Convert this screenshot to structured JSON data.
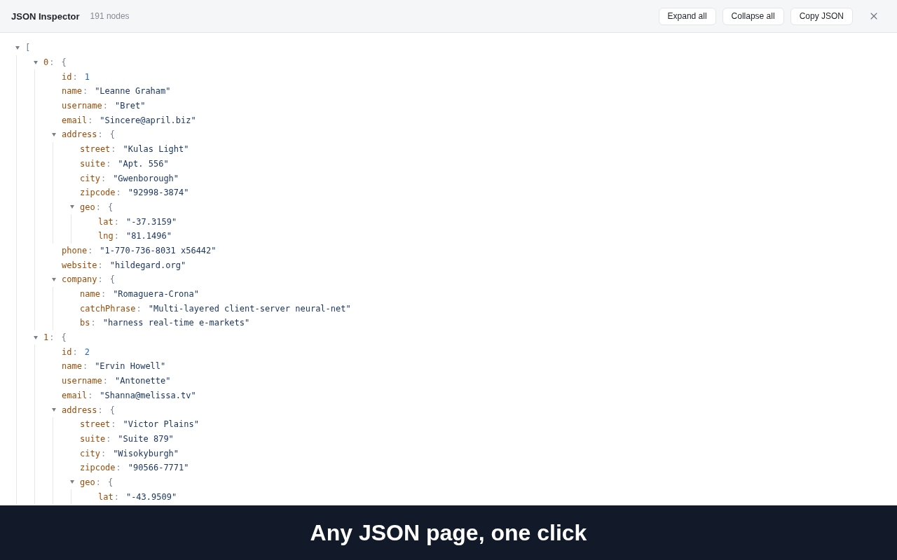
{
  "header": {
    "title": "JSON Inspector",
    "count": "191 nodes",
    "buttons": [
      "Expand all",
      "Collapse all",
      "Copy JSON"
    ]
  },
  "tree": {
    "separator": ":",
    "root": {
      "kind": "array",
      "bracket": "[",
      "expanded": true,
      "children": [
        {
          "key": "0",
          "kind": "object",
          "bracket": "{",
          "expanded": true,
          "children": [
            {
              "key": "id",
              "kind": "number",
              "value": "1"
            },
            {
              "key": "name",
              "kind": "string",
              "value": "\"Leanne Graham\""
            },
            {
              "key": "username",
              "kind": "string",
              "value": "\"Bret\""
            },
            {
              "key": "email",
              "kind": "string",
              "value": "\"Sincere@april.biz\""
            },
            {
              "key": "address",
              "kind": "object",
              "bracket": "{",
              "expanded": true,
              "children": [
                {
                  "key": "street",
                  "kind": "string",
                  "value": "\"Kulas Light\""
                },
                {
                  "key": "suite",
                  "kind": "string",
                  "value": "\"Apt. 556\""
                },
                {
                  "key": "city",
                  "kind": "string",
                  "value": "\"Gwenborough\""
                },
                {
                  "key": "zipcode",
                  "kind": "string",
                  "value": "\"92998-3874\""
                },
                {
                  "key": "geo",
                  "kind": "object",
                  "bracket": "{",
                  "expanded": true,
                  "children": [
                    {
                      "key": "lat",
                      "kind": "string",
                      "value": "\"-37.3159\""
                    },
                    {
                      "key": "lng",
                      "kind": "string",
                      "value": "\"81.1496\""
                    }
                  ]
                }
              ]
            },
            {
              "key": "phone",
              "kind": "string",
              "value": "\"1-770-736-8031 x56442\""
            },
            {
              "key": "website",
              "kind": "string",
              "value": "\"hildegard.org\""
            },
            {
              "key": "company",
              "kind": "object",
              "bracket": "{",
              "expanded": true,
              "children": [
                {
                  "key": "name",
                  "kind": "string",
                  "value": "\"Romaguera-Crona\""
                },
                {
                  "key": "catchPhrase",
                  "kind": "string",
                  "value": "\"Multi-layered client-server neural-net\""
                },
                {
                  "key": "bs",
                  "kind": "string",
                  "value": "\"harness real-time e-markets\""
                }
              ]
            }
          ]
        },
        {
          "key": "1",
          "kind": "object",
          "bracket": "{",
          "expanded": true,
          "children": [
            {
              "key": "id",
              "kind": "number",
              "value": "2"
            },
            {
              "key": "name",
              "kind": "string",
              "value": "\"Ervin Howell\""
            },
            {
              "key": "username",
              "kind": "string",
              "value": "\"Antonette\""
            },
            {
              "key": "email",
              "kind": "string",
              "value": "\"Shanna@melissa.tv\""
            },
            {
              "key": "address",
              "kind": "object",
              "bracket": "{",
              "expanded": true,
              "children": [
                {
                  "key": "street",
                  "kind": "string",
                  "value": "\"Victor Plains\""
                },
                {
                  "key": "suite",
                  "kind": "string",
                  "value": "\"Suite 879\""
                },
                {
                  "key": "city",
                  "kind": "string",
                  "value": "\"Wisokyburgh\""
                },
                {
                  "key": "zipcode",
                  "kind": "string",
                  "value": "\"90566-7771\""
                },
                {
                  "key": "geo",
                  "kind": "object",
                  "bracket": "{",
                  "expanded": true,
                  "children": [
                    {
                      "key": "lat",
                      "kind": "string",
                      "value": "\"-43.9509\""
                    }
                  ]
                }
              ]
            }
          ]
        }
      ]
    }
  },
  "banner": {
    "text": "Any JSON page, one click"
  }
}
